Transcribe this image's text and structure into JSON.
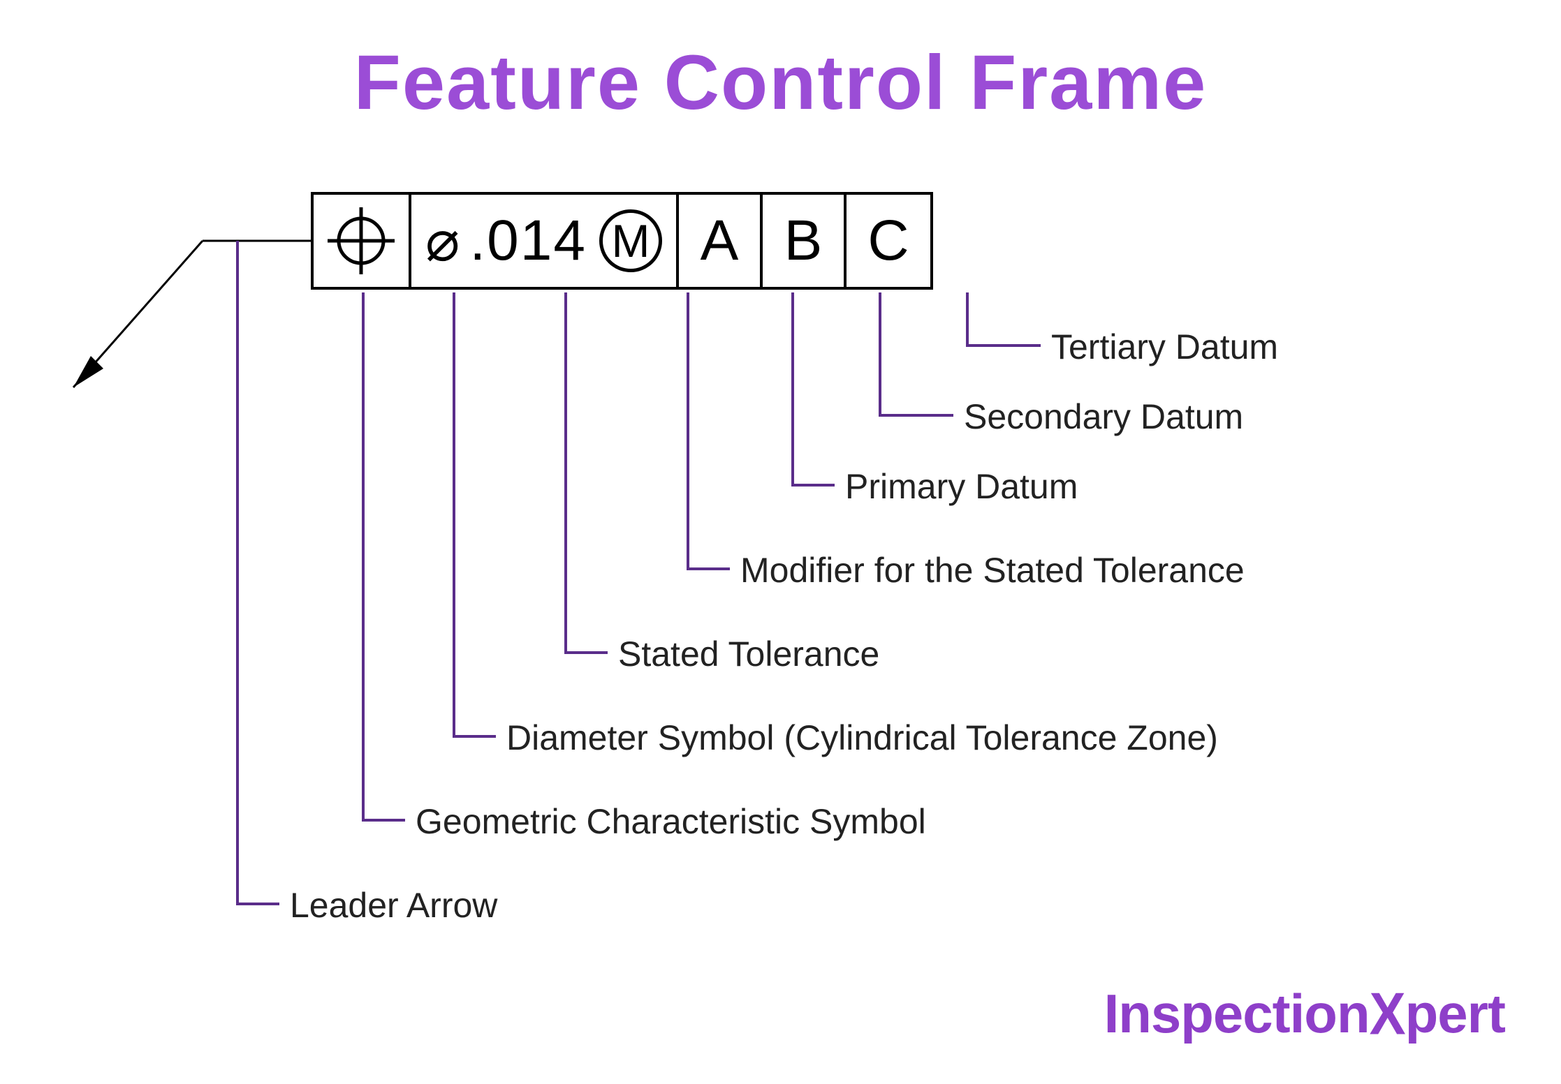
{
  "title": "Feature Control Frame",
  "fcf": {
    "symbol_name": "position-symbol",
    "tolerance": {
      "diameter_symbol": "⌀",
      "value": ".014",
      "modifier": "M"
    },
    "datums": {
      "primary": "A",
      "secondary": "B",
      "tertiary": "C"
    }
  },
  "callouts": {
    "tertiary_datum": "Tertiary Datum",
    "secondary_datum": "Secondary Datum",
    "primary_datum": "Primary Datum",
    "modifier": "Modifier for the Stated Tolerance",
    "stated_tolerance": "Stated Tolerance",
    "diameter_symbol": "Diameter Symbol (Cylindrical Tolerance Zone)",
    "geometric_symbol": "Geometric Characteristic Symbol",
    "leader_arrow": "Leader Arrow"
  },
  "logo": {
    "part1": "Inspection",
    "part2": "X",
    "part3": "pert"
  },
  "colors": {
    "accent": "#9b4dd6",
    "callout_line": "#5a2d8a"
  }
}
